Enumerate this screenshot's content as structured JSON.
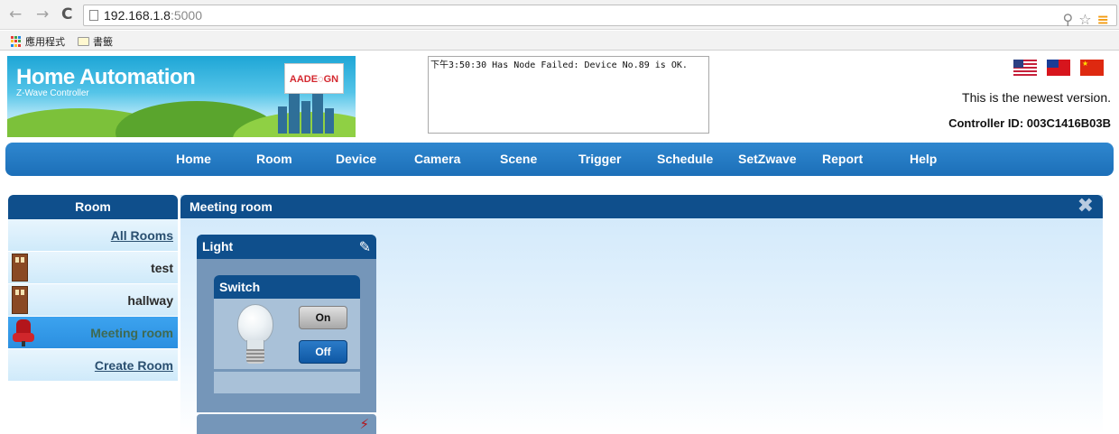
{
  "browser": {
    "back_glyph": "←",
    "forward_glyph": "→",
    "reload_glyph": "C",
    "url_host": "192.168.1.8",
    "url_port": ":5000",
    "key_glyph": "⚲",
    "star_glyph": "☆",
    "menu_glyph": "≡",
    "bookmarks": [
      {
        "label": "應用程式",
        "icon": "apps-grid-icon"
      },
      {
        "label": "書籤",
        "icon": "folder-icon"
      }
    ]
  },
  "header": {
    "banner_title": "Home Automation",
    "banner_subtitle": "Z-Wave Controller",
    "logo_text": "AADE◌GN",
    "status_message": "下午3:50:30 Has Node Failed: Device No.89 is OK.",
    "version_text": "This is the newest version.",
    "controller_id": "Controller ID: 003C1416B03B",
    "flags": [
      "us-flag-icon",
      "taiwan-flag-icon",
      "china-flag-icon"
    ]
  },
  "nav": {
    "items": [
      "Home",
      "Room",
      "Device",
      "Camera",
      "Scene",
      "Trigger",
      "Schedule",
      "SetZwave",
      "Report",
      "Help"
    ]
  },
  "room_panel": {
    "title": "Room",
    "all_rooms": "All Rooms",
    "rooms": [
      {
        "label": "test",
        "icon": "door-icon"
      },
      {
        "label": "hallway",
        "icon": "door-icon"
      },
      {
        "label": "Meeting room",
        "icon": "chair-icon",
        "active": true
      }
    ],
    "create_room": "Create Room"
  },
  "meeting_panel": {
    "title": "Meeting room",
    "close_glyph": "✖",
    "device_card": {
      "title": "Light",
      "edit_glyph": "✎",
      "switch": {
        "title": "Switch",
        "on_label": "On",
        "off_label": "Off",
        "state": "off"
      }
    },
    "unlink_glyph": "⚡"
  },
  "colors": {
    "nav_blue": "#1c6fb8",
    "panel_header": "#0f4f8c",
    "active_room": "#2b8fe0",
    "card_body": "#7596b9"
  }
}
